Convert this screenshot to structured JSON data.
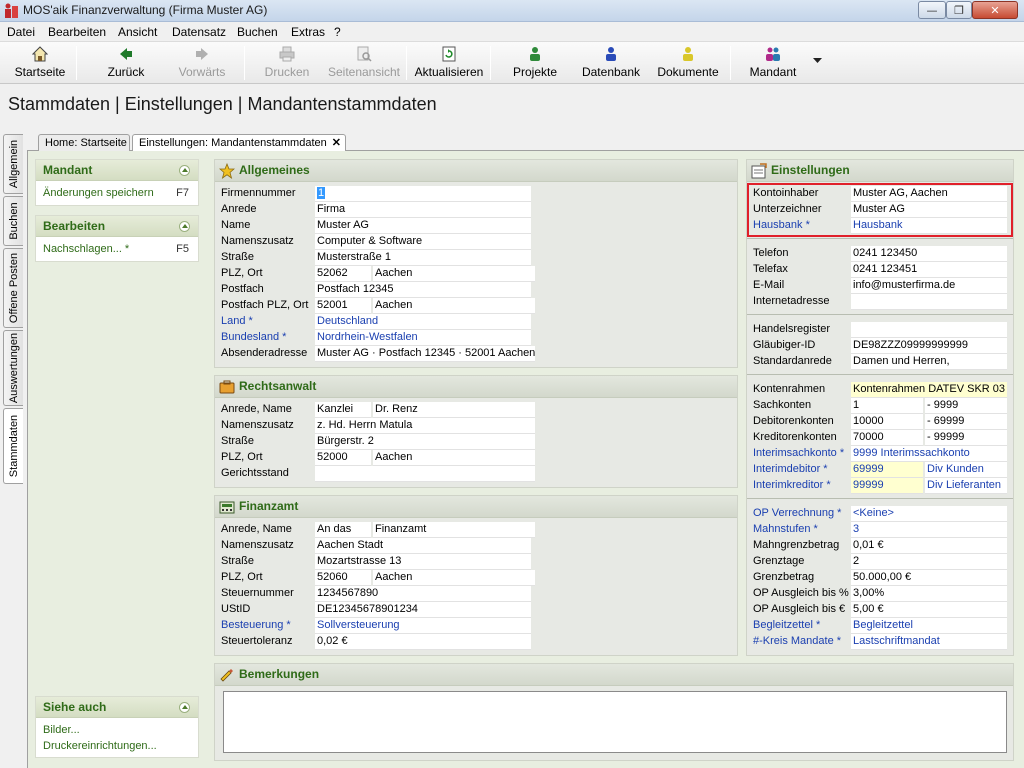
{
  "window": {
    "title": "MOS'aik Finanzverwaltung (Firma Muster AG)"
  },
  "menu": [
    "Datei",
    "Bearbeiten",
    "Ansicht",
    "Datensatz",
    "Buchen",
    "Extras",
    "?"
  ],
  "toolbar": {
    "startseite": "Startseite",
    "zurueck": "Zurück",
    "vorwaerts": "Vorwärts",
    "drucken": "Drucken",
    "seitenansicht": "Seitenansicht",
    "aktualisieren": "Aktualisieren",
    "projekte": "Projekte",
    "datenbank": "Datenbank",
    "dokumente": "Dokumente",
    "mandant": "Mandant"
  },
  "page_title": "Stammdaten | Einstellungen | Mandantenstammdaten",
  "vertical_tabs": [
    "Allgemein",
    "Buchen",
    "Offene Posten",
    "Auswertungen",
    "Stammdaten"
  ],
  "doc_tabs": [
    "Home: Startseite",
    "Einstellungen: Mandantenstammdaten"
  ],
  "left": {
    "mandant": {
      "title": "Mandant",
      "item": "Änderungen speichern",
      "key": "F7"
    },
    "bearbeiten": {
      "title": "Bearbeiten",
      "item": "Nachschlagen... *",
      "key": "F5"
    },
    "siehe": {
      "title": "Siehe auch",
      "items": [
        "Bilder...",
        "Druckereinrichtungen..."
      ]
    }
  },
  "allgemeines": {
    "title": "Allgemeines",
    "rows": [
      {
        "label": "Firmennummer",
        "value": "1"
      },
      {
        "label": "Anrede",
        "value": "Firma"
      },
      {
        "label": "Name",
        "value": "Muster AG"
      },
      {
        "label": "Namenszusatz",
        "value": "Computer & Software"
      },
      {
        "label": "Straße",
        "value": "Musterstraße 1"
      },
      {
        "label": "PLZ, Ort",
        "value": "52062",
        "value2": "Aachen"
      },
      {
        "label": "Postfach",
        "value": "Postfach 12345"
      },
      {
        "label": "Postfach PLZ, Ort",
        "value": "52001",
        "value2": "Aachen"
      },
      {
        "label": "Land *",
        "value": "Deutschland"
      },
      {
        "label": "Bundesland *",
        "value": "Nordrhein-Westfalen"
      },
      {
        "label": "Absenderadresse",
        "value": "Muster AG · Postfach 12345 · 52001 Aachen"
      }
    ]
  },
  "rechtsanwalt": {
    "title": "Rechtsanwalt",
    "rows": [
      {
        "label": "Anrede, Name",
        "value": "Kanzlei",
        "value2": "Dr. Renz"
      },
      {
        "label": "Namenszusatz",
        "value": "z. Hd. Herrn Matula"
      },
      {
        "label": "Straße",
        "value": "Bürgerstr. 2"
      },
      {
        "label": "PLZ, Ort",
        "value": "52000",
        "value2": "Aachen"
      },
      {
        "label": "Gerichtsstand",
        "value": ""
      }
    ]
  },
  "finanzamt": {
    "title": "Finanzamt",
    "rows": [
      {
        "label": "Anrede, Name",
        "value": "An das",
        "value2": "Finanzamt"
      },
      {
        "label": "Namenszusatz",
        "value": "Aachen Stadt"
      },
      {
        "label": "Straße",
        "value": "Mozartstrasse 13"
      },
      {
        "label": "PLZ, Ort",
        "value": "52060",
        "value2": "Aachen"
      },
      {
        "label": "Steuernummer",
        "value": "1234567890"
      },
      {
        "label": "UStID",
        "value": "DE12345678901234"
      },
      {
        "label": "Besteuerung *",
        "value": "Sollversteuerung"
      },
      {
        "label": "Steuertoleranz",
        "value": "0,02 €"
      }
    ]
  },
  "bemerkungen": {
    "title": "Bemerkungen"
  },
  "einstellungen": {
    "title": "Einstellungen",
    "g1": [
      {
        "label": "Kontoinhaber",
        "value": "Muster AG, Aachen"
      },
      {
        "label": "Unterzeichner",
        "value": "Muster AG"
      },
      {
        "label": "Hausbank *",
        "value": "Hausbank"
      }
    ],
    "g2": [
      {
        "label": "Telefon",
        "value": "0241 123450"
      },
      {
        "label": "Telefax",
        "value": "0241 123451"
      },
      {
        "label": "E-Mail",
        "value": "info@musterfirma.de"
      },
      {
        "label": "Internetadresse",
        "value": ""
      }
    ],
    "g3": [
      {
        "label": "Handelsregister",
        "value": ""
      },
      {
        "label": "Gläubiger-ID",
        "value": "DE98ZZZ09999999999"
      },
      {
        "label": "Standardanrede",
        "value": " Damen und Herren,"
      }
    ],
    "g4": [
      {
        "label": "Kontenrahmen",
        "value": "Kontenrahmen DATEV SKR 03"
      },
      {
        "label": "Sachkonten",
        "value": "1",
        "value2": "- 9999"
      },
      {
        "label": "Debitorenkonten",
        "value": "10000",
        "value2": "- 69999"
      },
      {
        "label": "Kreditorenkonten",
        "value": "70000",
        "value2": "- 99999"
      },
      {
        "label": "Interimsachkonto *",
        "value": "9999 Interimssachkonto"
      },
      {
        "label": "Interimdebitor *",
        "value": "69999",
        "value2": "Div Kunden"
      },
      {
        "label": "Interimkreditor *",
        "value": "99999",
        "value2": "Div Lieferanten"
      }
    ],
    "g5": [
      {
        "label": "OP Verrechnung *",
        "value": "<Keine>"
      },
      {
        "label": "Mahnstufen *",
        "value": "3"
      },
      {
        "label": "Mahngrenzbetrag",
        "value": "0,01 €"
      },
      {
        "label": "Grenztage",
        "value": "2"
      },
      {
        "label": "Grenzbetrag",
        "value": "50.000,00 €"
      },
      {
        "label": "OP Ausgleich bis %",
        "value": "3,00%"
      },
      {
        "label": "OP Ausgleich bis €",
        "value": "5,00 €"
      },
      {
        "label": "Begleitzettel *",
        "value": "Begleitzettel"
      },
      {
        "label": "#-Kreis Mandate *",
        "value": "Lastschriftmandat"
      }
    ]
  },
  "colors": {
    "accent_green": "#2f6b18",
    "link_blue": "#1a3fb0",
    "highlight_red": "#e0202a"
  }
}
